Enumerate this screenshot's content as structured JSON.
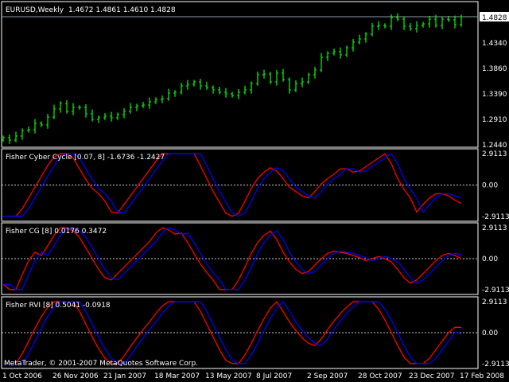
{
  "main": {
    "symbol_label": "EURUSD,Weekly",
    "ohlc_label": "1.4672 1.4861 1.4610 1.4828",
    "current_price": "1.4828",
    "price_ticks": [
      "1.4340",
      "1.3860",
      "1.3390",
      "1.2910",
      "1.2440"
    ],
    "bar_color": "#00ff00",
    "closes": [
      1.2573,
      1.2528,
      1.2603,
      1.2706,
      1.2721,
      1.284,
      1.281,
      1.2958,
      1.3107,
      1.3211,
      1.3062,
      1.3137,
      1.3137,
      1.3018,
      1.2914,
      1.2944,
      1.2973,
      1.2944,
      1.3003,
      1.3062,
      1.3137,
      1.3166,
      1.3181,
      1.3241,
      1.3285,
      1.33,
      1.3404,
      1.3419,
      1.3537,
      1.3567,
      1.3612,
      1.3537,
      1.3507,
      1.3463,
      1.3419,
      1.3389,
      1.3359,
      1.3419,
      1.3463,
      1.3582,
      1.3745,
      1.376,
      1.3612,
      1.3775,
      1.3656,
      1.3463,
      1.3582,
      1.3612,
      1.3745,
      1.3834,
      1.4071,
      1.4146,
      1.4175,
      1.4116,
      1.4249,
      1.4353,
      1.4413,
      1.4502,
      1.465,
      1.4665,
      1.465,
      1.4813,
      1.4783,
      1.465,
      1.4605,
      1.4665,
      1.4694,
      1.4783,
      1.4665,
      1.4783,
      1.4769,
      1.468,
      1.4828
    ]
  },
  "indicators": [
    {
      "title": "Fisher Cyber Cycle [0.07, 8] -1.6736 -1.2427",
      "max_label": "2.9113",
      "zero_label": "0.00",
      "min_label": "-2.9113",
      "red": [
        -2.9,
        -2.9,
        -2.9,
        -2.2,
        -1.2,
        -0.2,
        0.8,
        1.8,
        2.6,
        2.9,
        2.9,
        2.5,
        1.5,
        0.5,
        -0.3,
        -0.8,
        -1.5,
        -2.5,
        -2.6,
        -1.8,
        -1.0,
        -0.2,
        0.6,
        1.4,
        2.2,
        2.9,
        2.9,
        2.9,
        2.9,
        2.9,
        2.9,
        1.8,
        0.6,
        -0.6,
        -1.6,
        -2.6,
        -2.9,
        -2.6,
        -1.5,
        -0.3,
        0.6,
        1.2,
        1.6,
        1.3,
        0.6,
        -0.2,
        -0.6,
        -1.0,
        -1.2,
        -0.6,
        0.1,
        0.6,
        1.0,
        1.5,
        1.5,
        1.2,
        1.3,
        1.7,
        2.1,
        2.5,
        2.9,
        2.0,
        0.6,
        -0.4,
        -1.2,
        -2.5,
        -1.8,
        -1.2,
        -0.8,
        -0.8,
        -1.0,
        -1.4,
        -1.7
      ],
      "blue": [
        -2.9,
        -2.9,
        -2.9,
        -2.9,
        -2.2,
        -1.2,
        -0.2,
        0.8,
        1.8,
        2.6,
        2.9,
        2.9,
        2.5,
        1.5,
        0.5,
        -0.3,
        -0.8,
        -1.5,
        -2.5,
        -2.6,
        -1.8,
        -1.0,
        -0.2,
        0.6,
        1.4,
        2.2,
        2.9,
        2.9,
        2.9,
        2.9,
        2.9,
        2.9,
        1.8,
        0.6,
        -0.6,
        -1.6,
        -2.6,
        -2.9,
        -2.6,
        -1.5,
        -0.3,
        0.6,
        1.2,
        1.6,
        1.3,
        0.6,
        -0.2,
        -0.6,
        -1.0,
        -1.2,
        -0.6,
        0.1,
        0.6,
        1.0,
        1.5,
        1.5,
        1.2,
        1.3,
        1.7,
        2.1,
        2.5,
        2.9,
        2.0,
        0.6,
        -0.4,
        -1.2,
        -2.5,
        -1.8,
        -1.2,
        -0.8,
        -0.8,
        -1.0,
        -1.2
      ]
    },
    {
      "title": "Fisher CG [8] 0.0176 0.3472",
      "max_label": "2.9113",
      "zero_label": "0.00",
      "min_label": "-2.9113",
      "red": [
        -2.4,
        -2.9,
        -2.9,
        -1.5,
        -0.2,
        0.6,
        0.3,
        1.2,
        2.2,
        2.9,
        2.9,
        2.6,
        2.0,
        1.0,
        0.0,
        -1.0,
        -1.8,
        -2.0,
        -1.4,
        -0.8,
        -0.2,
        0.4,
        1.0,
        1.6,
        2.4,
        2.9,
        2.7,
        2.3,
        2.4,
        1.5,
        0.5,
        -0.5,
        -1.3,
        -2.0,
        -2.9,
        -2.9,
        -2.9,
        -2.0,
        -0.8,
        0.5,
        1.5,
        2.2,
        2.6,
        1.8,
        0.6,
        -0.3,
        -1.0,
        -1.4,
        -1.2,
        -0.6,
        0.0,
        0.5,
        0.7,
        0.6,
        0.5,
        0.3,
        0.1,
        -0.2,
        0.0,
        0.2,
        0.0,
        -0.3,
        -1.0,
        -1.8,
        -2.3,
        -2.0,
        -1.4,
        -0.8,
        -0.2,
        0.3,
        0.5,
        0.3,
        0.0
      ],
      "blue": [
        -2.4,
        -2.4,
        -2.9,
        -2.9,
        -1.5,
        -0.2,
        0.6,
        0.3,
        1.2,
        2.2,
        2.9,
        2.9,
        2.6,
        2.0,
        1.0,
        0.0,
        -1.0,
        -1.8,
        -2.0,
        -1.4,
        -0.8,
        -0.2,
        0.4,
        1.0,
        1.6,
        2.4,
        2.9,
        2.7,
        2.3,
        2.4,
        1.5,
        0.5,
        -0.5,
        -1.3,
        -2.0,
        -2.9,
        -2.9,
        -2.9,
        -2.0,
        -0.8,
        0.5,
        1.5,
        2.2,
        2.6,
        1.8,
        0.6,
        -0.3,
        -1.0,
        -1.4,
        -1.2,
        -0.6,
        0.0,
        0.5,
        0.7,
        0.6,
        0.5,
        0.3,
        0.1,
        -0.2,
        0.0,
        0.2,
        0.0,
        -0.3,
        -1.0,
        -1.8,
        -2.3,
        -2.0,
        -1.4,
        -0.8,
        -0.2,
        0.3,
        0.5,
        0.35
      ]
    },
    {
      "title": "Fisher RVI [8] 0.5041 -0.0918",
      "max_label": "2.9113",
      "zero_label": "0.00",
      "min_label": "-2.9113",
      "red": [
        -2.9,
        -2.9,
        -2.9,
        -2.0,
        -0.8,
        0.4,
        1.5,
        2.4,
        2.9,
        2.9,
        2.9,
        2.9,
        2.0,
        0.8,
        -0.4,
        -1.5,
        -2.4,
        -2.9,
        -2.9,
        -2.2,
        -1.3,
        -0.5,
        0.3,
        1.0,
        1.8,
        2.5,
        2.9,
        2.9,
        2.9,
        2.9,
        2.9,
        2.0,
        0.8,
        -0.4,
        -1.6,
        -2.6,
        -2.9,
        -2.9,
        -2.1,
        -1.0,
        0.2,
        1.3,
        2.3,
        2.9,
        2.0,
        1.0,
        0.2,
        -0.5,
        -1.0,
        -1.2,
        -0.6,
        0.3,
        1.1,
        1.8,
        2.4,
        2.9,
        2.9,
        2.9,
        2.9,
        2.2,
        1.2,
        0.0,
        -1.2,
        -2.3,
        -2.9,
        -2.9,
        -2.9,
        -2.4,
        -1.6,
        -0.8,
        0.0,
        0.5,
        0.5
      ],
      "blue": [
        -2.9,
        -2.9,
        -2.9,
        -2.9,
        -2.0,
        -0.8,
        0.4,
        1.5,
        2.4,
        2.9,
        2.9,
        2.9,
        2.9,
        2.0,
        0.8,
        -0.4,
        -1.5,
        -2.4,
        -2.9,
        -2.9,
        -2.2,
        -1.3,
        -0.5,
        0.3,
        1.0,
        1.8,
        2.5,
        2.9,
        2.9,
        2.9,
        2.9,
        2.9,
        2.0,
        0.8,
        -0.4,
        -1.6,
        -2.6,
        -2.9,
        -2.9,
        -2.1,
        -1.0,
        0.2,
        1.3,
        2.3,
        2.9,
        2.0,
        1.0,
        0.2,
        -0.5,
        -1.0,
        -1.2,
        -0.6,
        0.3,
        1.1,
        1.8,
        2.4,
        2.9,
        2.9,
        2.9,
        2.9,
        2.2,
        1.2,
        0.0,
        -1.2,
        -2.3,
        -2.9,
        -2.9,
        -2.9,
        -2.4,
        -1.6,
        -0.8,
        0.0,
        -0.1
      ]
    }
  ],
  "line_colors": {
    "signal": "#ff0000",
    "trigger": "#0000ff"
  },
  "copyright": "MetaTrader, © 2001-2007 MetaQuotes Software Corp.",
  "time_axis": [
    "1 Oct 2006",
    "26 Nov 2006",
    "21 Jan 2007",
    "18 Mar 2007",
    "13 May 2007",
    "8 Jul 2007",
    "2 Sep 2007",
    "28 Oct 2007",
    "23 Dec 2007",
    "17 Feb 2008"
  ]
}
